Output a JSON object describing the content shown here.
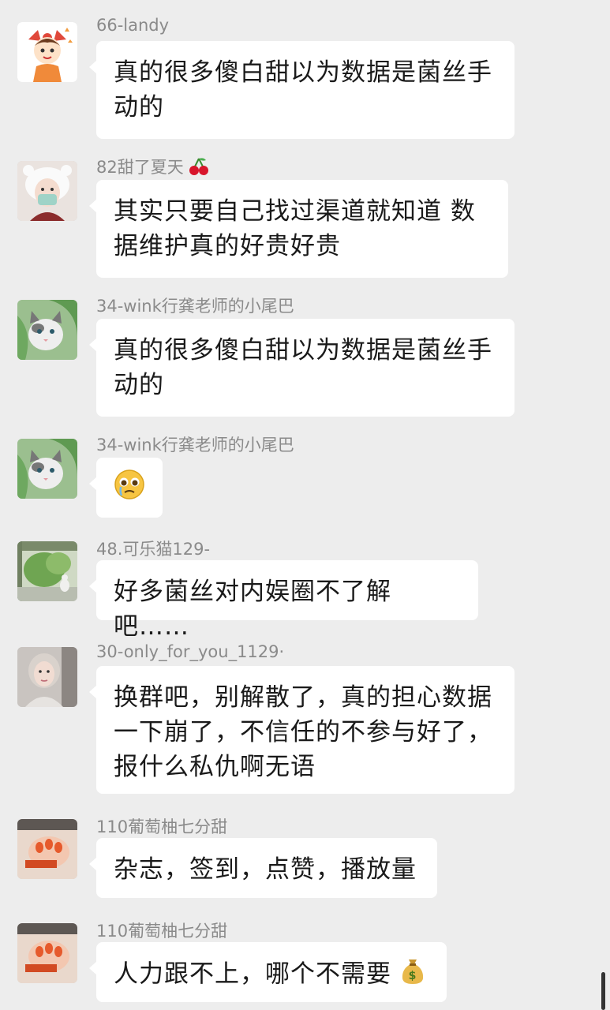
{
  "messages": [
    {
      "sender": "66-landy",
      "avatar_icon": "cartoon-boy-avatar",
      "text": "真的很多傻白甜以为数据是菌丝手动的"
    },
    {
      "sender": "82甜了夏天",
      "sender_emoji": "cherry-icon",
      "avatar_icon": "bear-hat-girl-avatar",
      "text": "其实只要自己找过渠道就知道 数据维护真的好贵好贵"
    },
    {
      "sender": "34-wink行龚老师的小尾巴",
      "avatar_icon": "cat-with-leaf-avatar",
      "text": "真的很多傻白甜以为数据是菌丝手动的"
    },
    {
      "sender": "34-wink行龚老师的小尾巴",
      "avatar_icon": "cat-with-leaf-avatar",
      "text": "",
      "emoji": "pleading-tears-emoji"
    },
    {
      "sender": "48.可乐猫129-",
      "avatar_icon": "cat-window-garden-avatar",
      "text": "好多菌丝对内娱圈不了解吧……"
    },
    {
      "sender": "30-only_for_you_1129·",
      "avatar_icon": "girl-portrait-avatar",
      "text": "换群吧，别解散了，真的担心数据一下崩了，不信任的不参与好了，报什么私仇啊无语"
    },
    {
      "sender": "110葡萄柚七分甜",
      "avatar_icon": "orange-nails-avatar",
      "text": "杂志，签到，点赞，播放量"
    },
    {
      "sender": "110葡萄柚七分甜",
      "avatar_icon": "orange-nails-avatar",
      "text": "人力跟不上，哪个不需要",
      "emoji": "money-bag-emoji"
    }
  ],
  "colors": {
    "background": "#ededed",
    "bubble": "#ffffff",
    "sender_name": "#8a8a8a",
    "text": "#1a1a1a"
  }
}
